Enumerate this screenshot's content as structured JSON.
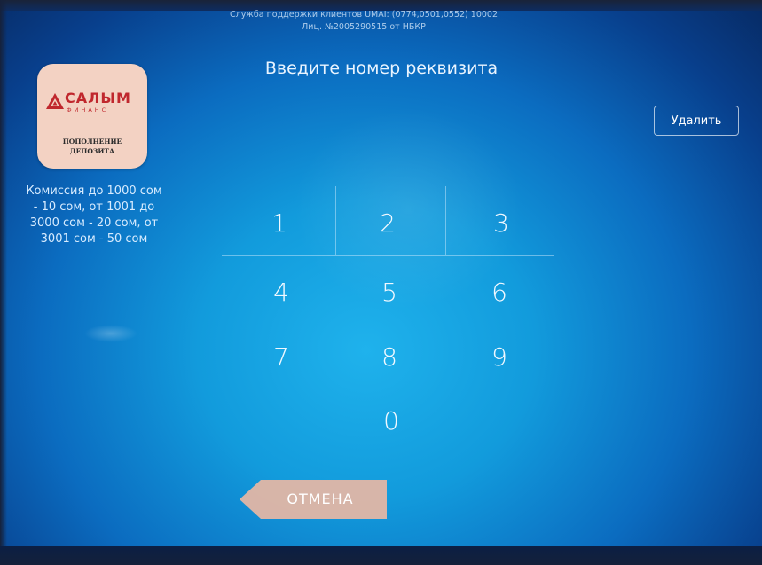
{
  "header": {
    "support_line1": "Служба поддержки клиентов UMAI: (0774,0501,0552) 10002",
    "support_line2": "Лиц. №2005290515 от НБКР",
    "title": "Введите номер реквизита"
  },
  "provider": {
    "logo_name": "САЛЫМ",
    "logo_sub": "ФИНАНС",
    "caption": "ПОПОЛНЕНИЕ ДЕПОЗИТА",
    "brand_color": "#c0272d",
    "card_color": "#f3d2c3"
  },
  "commission": {
    "text": "Комиссия до 1000 сом - 10 сом, от 1001 до 3000 сом - 20 сом, от 3001 сом - 50 сом"
  },
  "actions": {
    "delete_label": "Удалить",
    "cancel_label": "ОТМЕНА"
  },
  "keypad": {
    "keys": [
      "1",
      "2",
      "3",
      "4",
      "5",
      "6",
      "7",
      "8",
      "9",
      "0"
    ]
  },
  "colors": {
    "screen_center": "#1fb2ec",
    "screen_edge": "#072a63",
    "text": "#e9f4ff"
  }
}
